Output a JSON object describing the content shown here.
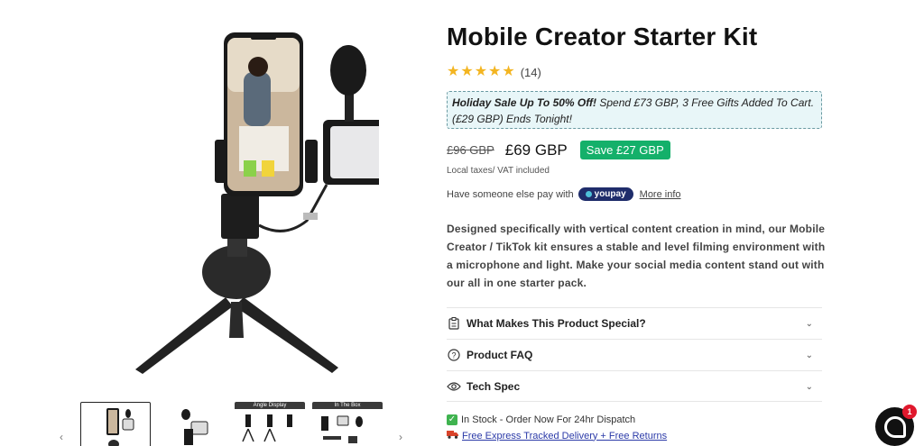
{
  "product": {
    "title": "Mobile Creator Starter Kit",
    "rating": 5,
    "review_count": "(14)",
    "promo": {
      "bold": "Holiday Sale Up To 50% Off!",
      "text": " Spend £73 GBP, 3 Free Gifts Added To Cart. (£29 GBP) Ends Tonight!"
    },
    "old_price": "£96 GBP",
    "price": "£69 GBP",
    "save_badge": "Save £27 GBP",
    "tax_note": "Local taxes/ VAT included",
    "pay_prefix": "Have someone else pay with",
    "youpay_label": "youpay",
    "more_info": "More info",
    "description": "Designed specifically with vertical content creation in mind, our Mobile Creator  / TikTok kit ensures a stable and level filming environment with a microphone and light. Make your social media content stand out with our all in one starter pack."
  },
  "accordion": [
    {
      "label": "What Makes This Product Special?",
      "icon": "clipboard-icon"
    },
    {
      "label": "Product FAQ",
      "icon": "question-icon"
    },
    {
      "label": "Tech Spec",
      "icon": "eye-icon"
    }
  ],
  "stock_text": "In Stock - Order Now For 24hr Dispatch",
  "delivery_text": "Free Express Tracked Delivery + Free Returns",
  "thumbnails": {
    "angle_label": "Angle Display",
    "box_label": "In The Box"
  },
  "chat_badge": "1",
  "colors": {
    "star": "#f3b521",
    "save_badge": "#14b06a",
    "promo_bg": "#e8f6f8",
    "youpay": "#1f2d6b",
    "link": "#2b3aa8"
  }
}
